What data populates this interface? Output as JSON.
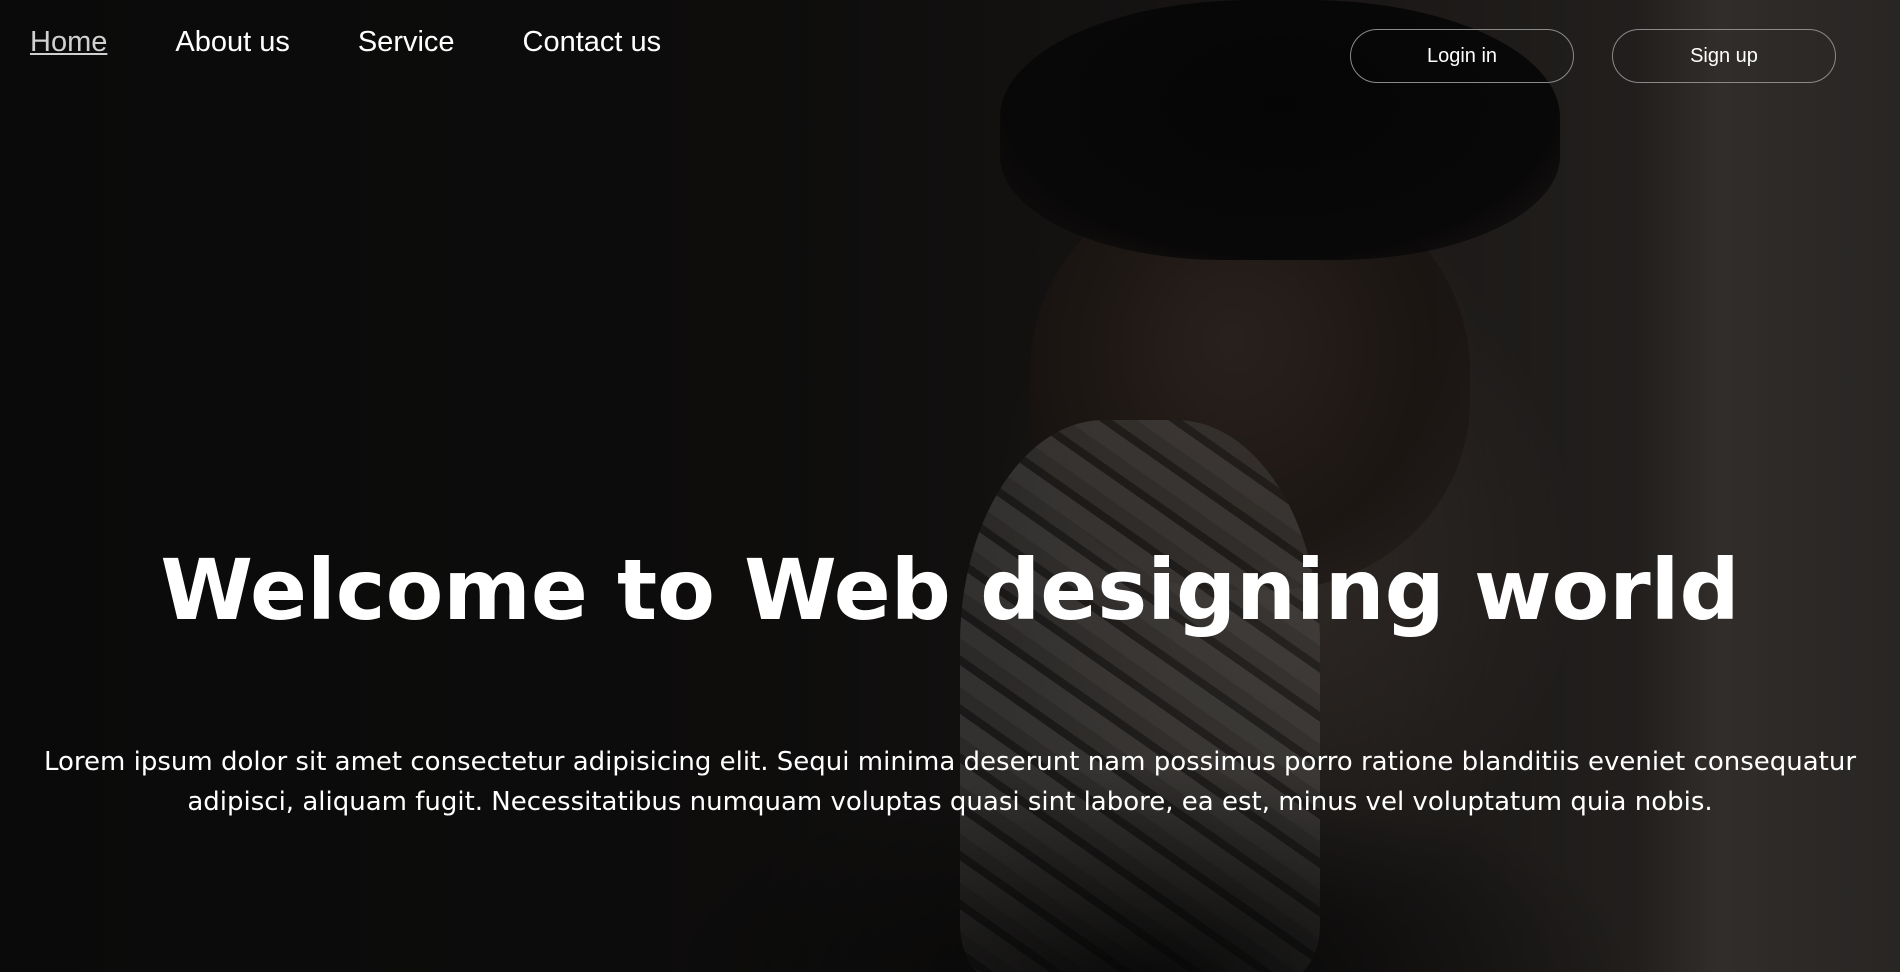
{
  "nav": {
    "links": [
      {
        "label": "Home",
        "active": true
      },
      {
        "label": "About us"
      },
      {
        "label": "Service"
      },
      {
        "label": "Contact us"
      }
    ],
    "login_label": "Login in",
    "signup_label": "Sign up"
  },
  "hero": {
    "title": "Welcome to Web designing world",
    "text": "Lorem ipsum dolor sit amet consectetur adipisicing elit. Sequi minima deserunt nam possimus porro ratione blanditiis eveniet consequatur adipisci, aliquam fugit. Necessitatibus numquam voluptas quasi sint labore, ea est, minus vel voluptatum quia nobis."
  },
  "colors": {
    "text": "#ffffff",
    "active_link": "#d0d0d0",
    "button_border": "#8a8a8a"
  }
}
